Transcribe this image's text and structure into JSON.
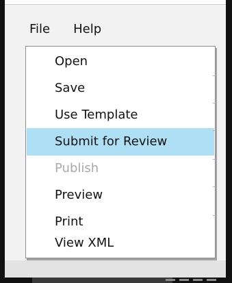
{
  "menubar": {
    "items": [
      {
        "label": "File"
      },
      {
        "label": "Help"
      }
    ]
  },
  "file_menu": {
    "items": [
      {
        "label": "Open",
        "state": "normal"
      },
      {
        "label": "Save",
        "state": "normal"
      },
      {
        "label": "Use Template",
        "state": "normal"
      },
      {
        "label": "Submit for Review",
        "state": "highlighted"
      },
      {
        "label": "Publish",
        "state": "disabled"
      },
      {
        "label": "Preview",
        "state": "normal"
      },
      {
        "label": "Print",
        "state": "normal"
      },
      {
        "label": "View XML",
        "state": "normal"
      }
    ]
  },
  "colors": {
    "highlight": "#aedff5",
    "disabled_text": "#a9a9a9",
    "text": "#111111"
  }
}
